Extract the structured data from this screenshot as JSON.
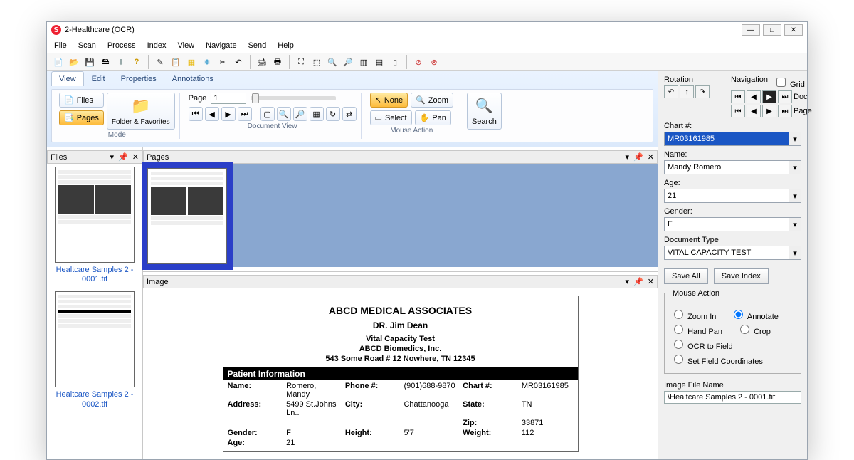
{
  "title": "2-Healthcare (OCR)",
  "menu": [
    "File",
    "Scan",
    "Process",
    "Index",
    "View",
    "Navigate",
    "Send",
    "Help"
  ],
  "ribbon": {
    "tabs": [
      "View",
      "Edit",
      "Properties",
      "Annotations"
    ],
    "files_btn": "Files",
    "pages_btn": "Pages",
    "folder_btn": "Folder & Favorites",
    "mode_label": "Mode",
    "page_label": "Page",
    "page_value": "1",
    "docview_label": "Document View",
    "none_btn": "None",
    "zoom_btn": "Zoom",
    "select_btn": "Select",
    "pan_btn": "Pan",
    "mouse_label": "Mouse Action",
    "search_btn": "Search"
  },
  "rightpanel": {
    "rotation_label": "Rotation",
    "navigation_label": "Navigation",
    "grid_label": "Grid",
    "doc_label": "Doc",
    "page_label": "Page",
    "fields": {
      "chart_label": "Chart #:",
      "chart_value": "MR03161985",
      "name_label": "Name:",
      "name_value": "Mandy Romero",
      "age_label": "Age:",
      "age_value": "21",
      "gender_label": "Gender:",
      "gender_value": "F",
      "doctype_label": "Document Type",
      "doctype_value": "VITAL CAPACITY TEST"
    },
    "save_all": "Save All",
    "save_index": "Save Index",
    "mouse_action": {
      "legend": "Mouse Action",
      "opts": [
        "Zoom In",
        "Annotate",
        "Hand Pan",
        "Crop",
        "OCR to Field",
        "Set Field Coordinates"
      ],
      "selected": "Annotate"
    },
    "imgfile_label": "Image File Name",
    "imgfile_value": "\\Healtcare Samples 2 - 0001.tif"
  },
  "panels": {
    "files": "Files",
    "pages": "Pages",
    "image": "Image",
    "file_list": [
      "Healtcare Samples 2 - 0001.tif",
      "Healtcare Samples 2 - 0002.tif"
    ]
  },
  "document": {
    "org": "ABCD MEDICAL ASSOCIATES",
    "doctor": "DR. Jim Dean",
    "test": "Vital Capacity Test",
    "company": "ABCD Biomedics, Inc.",
    "addr": "543 Some Road # 12 Nowhere, TN 12345",
    "section": "Patient Information",
    "rows": {
      "name_l": "Name:",
      "name_v": "Romero, Mandy",
      "phone_l": "Phone #:",
      "phone_v": "(901)688-9870",
      "chart_l": "Chart #:",
      "chart_v": "MR03161985",
      "address_l": "Address:",
      "address_v": "5499 St.Johns Ln..",
      "city_l": "City:",
      "city_v": "Chattanooga",
      "state_l": "State:",
      "state_v": "TN",
      "zip_l": "Zip:",
      "zip_v": "33871",
      "gender_l": "Gender:",
      "gender_v": "F",
      "height_l": "Height:",
      "height_v": "5'7",
      "weight_l": "Weight:",
      "weight_v": "112",
      "age_l": "Age:",
      "age_v": "21"
    }
  }
}
